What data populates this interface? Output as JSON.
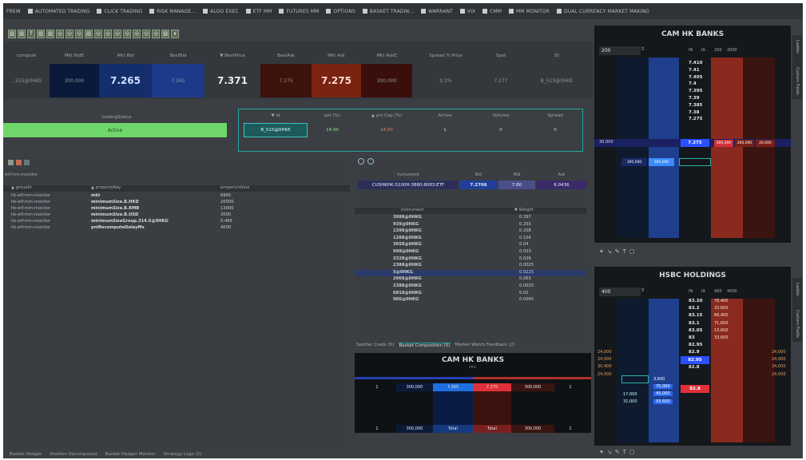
{
  "menubar": {
    "items": [
      "FREW",
      "AUTOMATED TRADING",
      "CLICK TRADING",
      "RISK MANAGE...",
      "ALGO EXEC",
      "ETF MM",
      "FUTURES MM",
      "OPTIONS",
      "BASKET TRADIN...",
      "WARRANT",
      "VIX",
      "CMM",
      "MM MONITOR",
      "DUAL CURRENCY MARKET MAKING"
    ]
  },
  "toolbar": {
    "icons": [
      "chart-icon",
      "chart-icon",
      "up-arrow-icon",
      "chart-icon",
      "chart-icon",
      "target-icon",
      "target-icon",
      "target-icon",
      "chart-icon",
      "target-icon",
      "target-icon",
      "target-icon",
      "target-icon",
      "target-icon",
      "target-icon",
      "target-icon",
      "chart-icon",
      "pause-icon"
    ]
  },
  "quote": {
    "headers": [
      "compute",
      "Mkt BidE",
      "Mkt Bid",
      "BestBid",
      "▼ BestPrice",
      "BestAsk",
      "Mkt Ask",
      "Mkt AskE",
      "Spread % Price",
      "Spot",
      "ID"
    ],
    "values": [
      "...515@0HKE",
      "300,000",
      "7.265",
      "7.265",
      "7.371",
      "7.275",
      "7.275",
      "300,000",
      "0.1%",
      "7.277",
      "B_515@0HKE"
    ]
  },
  "status": {
    "header": "tradingStatus",
    "value": "Active"
  },
  "basket_sel": {
    "headers": [
      "▼ id",
      "pnl (%)",
      "▲ pnl Cap (%)",
      "Active",
      "Volume",
      "Spread"
    ],
    "values": [
      "B_515@0HKE",
      "14.00",
      "14.00",
      "1",
      "0",
      "0"
    ]
  },
  "props": {
    "title": "etf-hm-monitor",
    "headers": [
      "▲ groupId",
      "▲ propertyKey",
      "propertyValue"
    ],
    "rows": [
      [
        "hk-etf-mm-monitor",
        "mkt",
        "6965"
      ],
      [
        "hk-etf-mm-monitor",
        "minimumSize.B.HKD",
        "20000"
      ],
      [
        "hk-etf-mm-monitor",
        "minimumSize.B.RMB",
        "13000"
      ],
      [
        "hk-etf-mm-monitor",
        "minimumSize.B.USD",
        "2000"
      ],
      [
        "hk-etf-mm-monitor",
        "minimumSizeGroup.314.5@0HKG",
        "0.465"
      ],
      [
        "hk-etf-mm-monitor",
        "pnlRecomputeDelayMs",
        "4000"
      ]
    ]
  },
  "instrument_strip": {
    "headers": [
      "Instrument",
      "Bid",
      "Mid",
      "Ask"
    ],
    "values": [
      "CUSHKHK:5100H:3880:8083:ETF",
      "7.2766",
      "7.80",
      "6.0436"
    ]
  },
  "instrument_list": {
    "headers": [
      "Instrument",
      "▼ Weight"
    ],
    "rows": [
      [
        "3988@0HKG",
        "0.397"
      ],
      [
        "939@0HKG",
        "0.255"
      ],
      [
        "1398@0HKG",
        "0.208"
      ],
      [
        "1288@0HKG",
        "0.104"
      ],
      [
        "3658@0HKG",
        "0.04"
      ],
      [
        "998@0HKG",
        "0.033"
      ],
      [
        "3328@0HKG",
        "0.026"
      ],
      [
        "2388@0HKG",
        "0.0025"
      ],
      [
        "5@0HKG",
        "0.0225"
      ],
      [
        "2968@0HKG",
        "0.063"
      ],
      [
        "2388@0HKG",
        "0.0025"
      ],
      [
        "6818@0HKG",
        "0.02"
      ],
      [
        "966@0HKG",
        "0.0065"
      ]
    ]
  },
  "mid_tabs": [
    "Spotter Creds (5)",
    "Basket Composition (5)",
    "Market Watch Feedback (2)"
  ],
  "mini_ladder": {
    "title": "CAM HK BANKS",
    "subtitle": "MKE",
    "row1": [
      "1",
      "300,000",
      "7.265",
      "7.275",
      "300,000",
      "1"
    ],
    "row2": [
      "1",
      "300,000",
      "Total",
      "Total",
      "300,000",
      "1"
    ]
  },
  "bottom_tabs": [
    "Basket Hedger",
    "Position Decomposed",
    "Basket Hedger Monitor",
    "Strategy Logs (2)"
  ],
  "ladder1": {
    "title": "CAM HK BANKS",
    "qty": "200",
    "headers": [
      "IN",
      "IA",
      "200",
      "2000"
    ],
    "prices": [
      "7.410",
      "7.41",
      "7.405",
      "7.4",
      "7.395",
      "7.39",
      "7.385",
      "7.38",
      "7.275"
    ],
    "bid_level": [
      "300,000",
      "300,000"
    ],
    "row_left": "30,000",
    "row_right": [
      "300,000",
      "200,000",
      "20,000"
    ]
  },
  "ladder2": {
    "title": "HSBC HOLDINGS",
    "qty": "400",
    "headers": [
      "IN",
      "IA",
      "400",
      "4000"
    ],
    "prices": [
      "83.20",
      "83.2",
      "83.15",
      "83.1",
      "83.05",
      "83",
      "82.95",
      "82.9",
      "82.85",
      "82.8"
    ],
    "ask_sizes": [
      "78,400",
      "33,600",
      "66,400",
      "71,600",
      "13,600",
      "33,600"
    ],
    "bid_sizes": [
      "3,600",
      "70,000",
      "45,000",
      "93,600"
    ],
    "bid_left": [
      "17,600",
      "32,000"
    ],
    "far_left": [
      "24,000",
      "24,000",
      "30,400",
      "24,000"
    ],
    "far_right": [
      "24,000",
      "24,000",
      "24,000",
      "24,000"
    ]
  },
  "side_tabs": [
    "Ladder",
    "Custom Fields"
  ],
  "colors": {
    "bg": "#3b3f43",
    "green": "#6fd66a",
    "teal": "#23a5a5",
    "blue_bid": "#1e3f8e",
    "red_ask": "#8e2a1e"
  }
}
